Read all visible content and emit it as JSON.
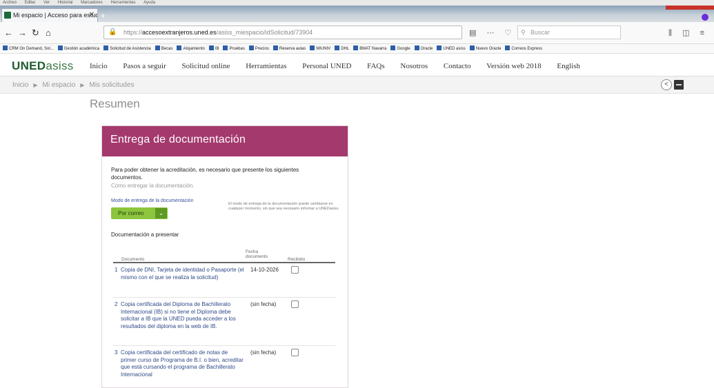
{
  "browser": {
    "menus": [
      "Archivo",
      "Editar",
      "Ver",
      "Historial",
      "Marcadores",
      "Herramientas",
      "Ayuda"
    ],
    "tab_title": "Mi espacio | Acceso para estud",
    "tab_close": "✕",
    "tab_plus": "+",
    "url_prefix": "https://",
    "url_host": "accesoextranjeros.uned.es",
    "url_path": "/asiss_miespacio/idSolicitud/73904",
    "search_placeholder": "Buscar",
    "bookmarks": [
      "CRM On Demand, Sol...",
      "Gestión académica",
      "Solicitud de Asistencia",
      "Becas",
      "Alojamiento",
      "IB",
      "Pruebas",
      "Precios",
      "Reserva aulas",
      "MIUNIV",
      "DHL",
      "BMAT Navarra",
      "Google",
      "Oracle",
      "UNED asiss",
      "Nuevo Oracle",
      "Correos Express"
    ]
  },
  "site": {
    "logo_bold": "UNED",
    "logo_light": "asiss",
    "nav": [
      "Inicio",
      "Pasos a seguir",
      "Solicitud online",
      "Herramientas",
      "Personal UNED",
      "FAQs",
      "Nosotros",
      "Contacto",
      "Versión web 2018",
      "English"
    ]
  },
  "breadcrumb": [
    "Inicio",
    "Mi espacio",
    "Mis solicitudes"
  ],
  "page_title": "Resumen",
  "card": {
    "title": "Entrega de documentación",
    "intro": "Para poder obtener la acreditación, es necesario que presente los siguientes documentos.",
    "how_link": "Cómo entregar la documentación.",
    "mode_label": "Modo de entrega de la documentación",
    "mode_value": "Por correo",
    "mode_note": "El modo de entrega de la documentación puede cambiarse en cualquier momento, sin que sea necesario informar a UNEDasiss.",
    "docs_title": "Documentación a presentar",
    "table": {
      "headers": {
        "document": "Documento",
        "fecha": "Fecha documento",
        "recibido": "Recibido"
      },
      "rows": [
        {
          "num": "1",
          "text": "Copia de DNI, Tarjeta de identidad o Pasaporte (el mismo con el que se realiza la solicitud)",
          "date": "14-10-2026",
          "received": false
        },
        {
          "num": "2",
          "text": "Copia certificada del Diploma de Bachillerato Internacional (IB) si no tiene el Diploma debe solicitar a IB que la UNED pueda acceder a los resultados del diploma en la web de IB.",
          "date": "(sin fecha)",
          "received": false
        },
        {
          "num": "3",
          "text": "Copia certificada del certificado de notas de primer curso de Programa de B.I. o bien, acreditar que está cursando el programa de Bachillerato Internacional",
          "date": "(sin fecha)",
          "received": false
        }
      ]
    }
  },
  "colors": {
    "card_header": "#a4396d",
    "logo_green": "#1f5c2f",
    "select_green": "#8dc53e",
    "link_blue": "#2f4a88"
  }
}
